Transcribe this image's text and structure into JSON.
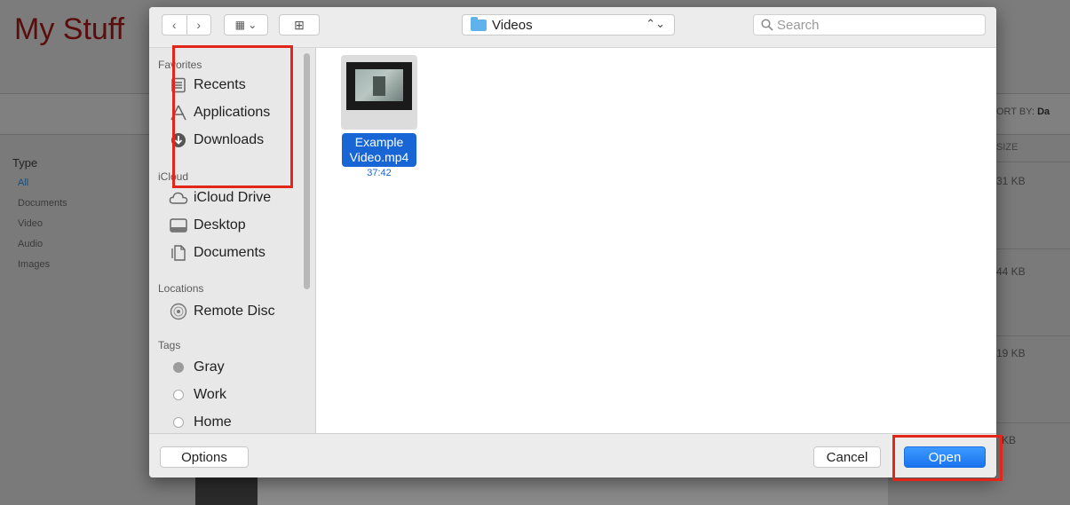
{
  "background_app": {
    "title": "My Stuff",
    "type_heading": "Type",
    "type_items": [
      "All",
      "Documents",
      "Video",
      "Audio",
      "Images"
    ],
    "sort_label": "ORT BY:",
    "sort_value": "Da",
    "size_header": "SIZE",
    "sizes": [
      "31 KB",
      "44 KB",
      "19 KB",
      "KB"
    ]
  },
  "dialog": {
    "toolbar": {
      "back_glyph": "‹",
      "forward_glyph": "›",
      "view_glyph": "▦ ⌄",
      "new_folder_glyph": "⊞",
      "location": "Videos",
      "location_chevron": "⌃⌄",
      "search_placeholder": "Search"
    },
    "sidebar": {
      "favorites_heading": "Favorites",
      "favorites": [
        {
          "label": "Recents",
          "icon": "recents-icon"
        },
        {
          "label": "Applications",
          "icon": "applications-icon"
        },
        {
          "label": "Downloads",
          "icon": "downloads-icon"
        }
      ],
      "icloud_heading": "iCloud",
      "icloud": [
        {
          "label": "iCloud Drive",
          "icon": "cloud-icon"
        },
        {
          "label": "Desktop",
          "icon": "desktop-icon"
        },
        {
          "label": "Documents",
          "icon": "documents-icon"
        }
      ],
      "locations_heading": "Locations",
      "locations": [
        {
          "label": "Remote Disc",
          "icon": "disc-icon"
        }
      ],
      "tags_heading": "Tags",
      "tags": [
        {
          "label": "Gray",
          "color": "#9b9b9b"
        },
        {
          "label": "Work",
          "color": "#ffffff"
        },
        {
          "label": "Home",
          "color": "#ffffff"
        }
      ]
    },
    "file": {
      "name_line1": "Example",
      "name_line2": "Video.mp4",
      "duration": "37:42"
    },
    "buttons": {
      "options": "Options",
      "cancel": "Cancel",
      "open": "Open"
    }
  },
  "colors": {
    "accent": "#1a73ef",
    "highlight": "#e3261a",
    "folder": "#5fb2ec"
  }
}
